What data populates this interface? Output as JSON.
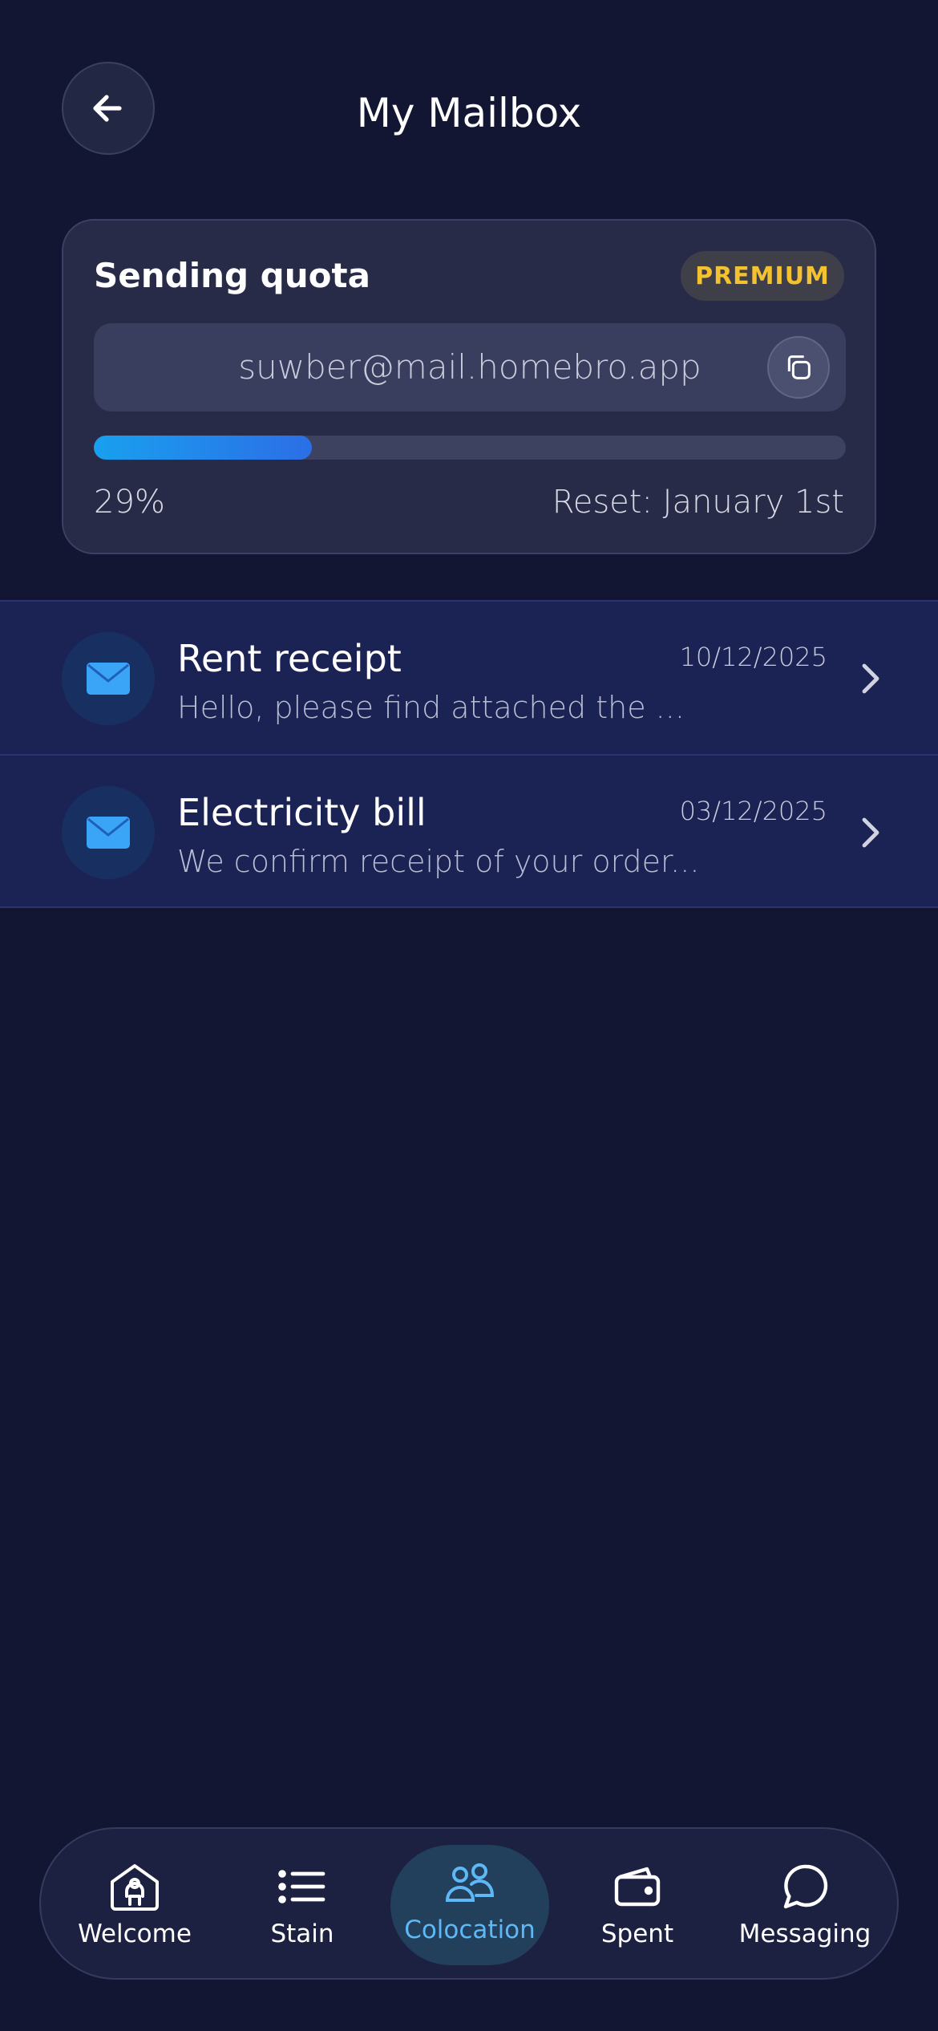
{
  "header": {
    "title": "My Mailbox"
  },
  "quota": {
    "title": "Sending quota",
    "badge": "PREMIUM",
    "email": "suwber@mail.homebro.app",
    "progress_percent": 29,
    "percent_label": "29%",
    "reset_label": "Reset: January 1st"
  },
  "mails": [
    {
      "subject": "Rent receipt",
      "preview": "Hello, please find attached the ...",
      "date": "10/12/2025"
    },
    {
      "subject": "Electricity bill",
      "preview": "We confirm receipt of your order...",
      "date": "03/12/2025"
    }
  ],
  "nav": {
    "items": [
      {
        "label": "Welcome",
        "icon": "house-icon"
      },
      {
        "label": "Stain",
        "icon": "list-icon"
      },
      {
        "label": "Colocation",
        "icon": "people-icon",
        "active": true
      },
      {
        "label": "Spent",
        "icon": "wallet-icon"
      },
      {
        "label": "Messaging",
        "icon": "chat-bubble-icon"
      }
    ]
  },
  "colors": {
    "background": "#121632",
    "accent": "#5fb8f6",
    "premium": "#f4c22e"
  }
}
